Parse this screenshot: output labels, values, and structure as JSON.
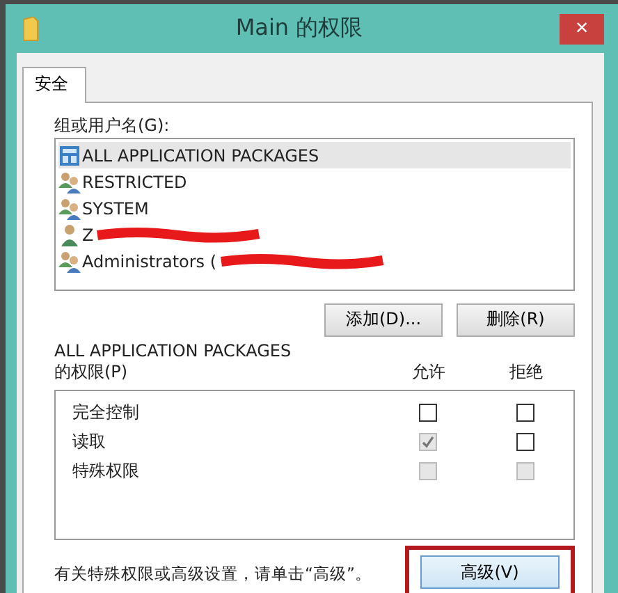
{
  "window": {
    "title": "Main 的权限",
    "close": "×"
  },
  "tabs": [
    {
      "label": "安全",
      "selected": true
    }
  ],
  "users": {
    "label": "组或用户名(G):",
    "items": [
      {
        "kind": "package",
        "name": "ALL APPLICATION PACKAGES",
        "selected": true,
        "redacted": false
      },
      {
        "kind": "group",
        "name": "RESTRICTED",
        "selected": false,
        "redacted": false
      },
      {
        "kind": "group",
        "name": "SYSTEM",
        "selected": false,
        "redacted": false
      },
      {
        "kind": "user",
        "name": "Z",
        "selected": false,
        "redacted": true
      },
      {
        "kind": "group",
        "name": "Administrators (",
        "selected": false,
        "redacted": true
      }
    ],
    "buttons": [
      "添加(D)...",
      "删除(R)"
    ]
  },
  "permissions": {
    "label_line1": "ALL APPLICATION PACKAGES",
    "label_line2": "的权限(P)",
    "columns": [
      "允许",
      "拒绝"
    ],
    "rows": [
      {
        "name": "完全控制",
        "allow": {
          "checked": false,
          "disabled": false
        },
        "deny": {
          "checked": false,
          "disabled": false
        }
      },
      {
        "name": "读取",
        "allow": {
          "checked": true,
          "disabled": true
        },
        "deny": {
          "checked": false,
          "disabled": false
        }
      },
      {
        "name": "特殊权限",
        "allow": {
          "checked": false,
          "disabled": true
        },
        "deny": {
          "checked": false,
          "disabled": true
        }
      }
    ]
  },
  "footer": {
    "hint": "有关特殊权限或高级设置，请单击“高级”。",
    "advanced": {
      "label": "高级(V)",
      "highlighted": true
    }
  }
}
